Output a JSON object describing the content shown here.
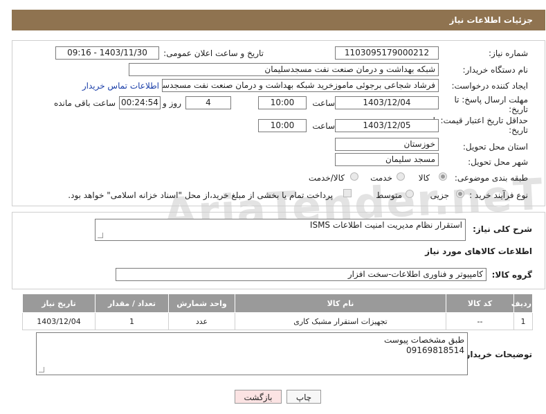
{
  "header": {
    "title": "جزئیات اطلاعات نیاز"
  },
  "watermark": "AriaTender.neT",
  "form": {
    "need_number": {
      "label": "شماره نیاز:",
      "value": "1103095179000212"
    },
    "announce_datetime": {
      "label": "تاریخ و ساعت اعلان عمومی:",
      "value": "1403/11/30 - 09:16"
    },
    "buyer_org": {
      "label": "نام دستگاه خریدار:",
      "value": "شبکه بهداشت و درمان صنعت نفت مسجدسلیمان"
    },
    "requester": {
      "label": "ایجاد کننده درخواست:",
      "value": "فرشاد شجاعی برجوئی ماموزخرید شبکه بهداشت و درمان صنعت نفت مسجدسلیمان",
      "contact_link": "اطلاعات تماس خریدار"
    },
    "reply_deadline": {
      "label_line1": "مهلت ارسال پاسخ: تا",
      "label_line2": "تاریخ:",
      "date": "1403/12/04",
      "time_label": "ساعت",
      "time": "10:00",
      "days": "4",
      "days_label": "روز و",
      "remaining": "00:24:54",
      "remaining_label": "ساعت باقی مانده"
    },
    "price_validity": {
      "label_line1": "حداقل تاریخ اعتبار قیمت: تا",
      "label_line2": "تاریخ:",
      "date": "1403/12/05",
      "time_label": "ساعت",
      "time": "10:00"
    },
    "province": {
      "label": "استان محل تحویل:",
      "value": "خوزستان"
    },
    "city": {
      "label": "شهر محل تحویل:",
      "value": "مسجد سلیمان"
    },
    "category": {
      "label": "طبقه بندی موضوعی:",
      "options": [
        "کالا",
        "خدمت",
        "کالا/خدمت"
      ],
      "selected": "کالا"
    },
    "process": {
      "label": "نوع فرآیند خرید :",
      "options": [
        "جزیی",
        "متوسط"
      ],
      "selected": "جزیی",
      "payment_note": "پرداخت تمام یا بخشی از مبلغ خرید،از محل \"اسناد خزانه اسلامی\" خواهد بود."
    }
  },
  "description": {
    "label": "شرح کلی نیاز:",
    "value": "استقرار نظام مدیریت امنیت اطلاعات ISMS"
  },
  "goods_section": {
    "title": "اطلاعات کالاهای مورد نیاز",
    "group_label": "گروه کالا:",
    "group_value": "کامپیوتر و فناوری اطلاعات-سخت افزار"
  },
  "table": {
    "headers": [
      "ردیف",
      "کد کالا",
      "نام کالا",
      "واحد شمارش",
      "تعداد / مقدار",
      "تاریخ نیاز"
    ],
    "rows": [
      [
        "1",
        "--",
        "تجهیزات استقرار مشبک کاری",
        "عدد",
        "1",
        "1403/12/04"
      ]
    ]
  },
  "buyer_notes": {
    "label": "توضیحات خریدار:",
    "line1": "طبق مشخصات پیوست",
    "line2": "09169818514"
  },
  "buttons": {
    "print": "چاپ",
    "back": "بازگشت"
  },
  "colors": {
    "header_bg": "#8f7350",
    "table_header_bg": "#9a9a9a",
    "link": "#1a3ea8",
    "back_button_bg": "#fbe3e3"
  }
}
